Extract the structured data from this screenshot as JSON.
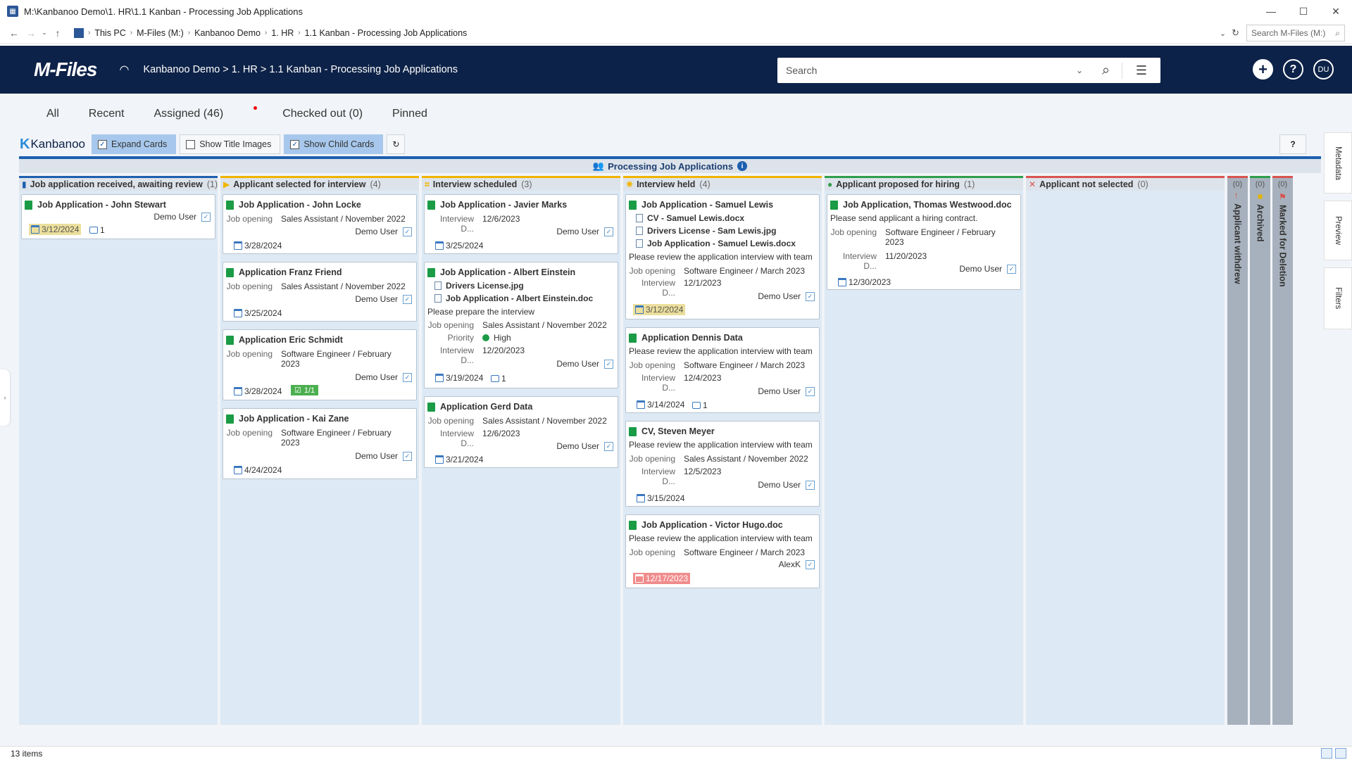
{
  "window": {
    "title": "M:\\Kanbanoo Demo\\1. HR\\1.1 Kanban - Processing Job Applications",
    "minimize": "—",
    "maximize": "☐",
    "close": "✕"
  },
  "address": {
    "crumbs": [
      "This PC",
      "M-Files (M:)",
      "Kanbanoo Demo",
      "1. HR",
      "1.1 Kanban - Processing Job Applications"
    ],
    "search_placeholder": "Search M-Files (M:)"
  },
  "header": {
    "logo": "M-Files",
    "path": "Kanbanoo Demo > 1. HR > 1.1 Kanban - Processing Job Applications",
    "search_placeholder": "Search",
    "user_initials": "DU"
  },
  "tabs": [
    "All",
    "Recent",
    "Assigned (46)",
    "Checked out (0)",
    "Pinned"
  ],
  "toolbar": {
    "logo": "Kanbanoo",
    "expand_cards": "Expand Cards",
    "show_title_images": "Show Title Images",
    "show_child_cards": "Show Child Cards",
    "help": "?"
  },
  "board": {
    "title": "Processing Job Applications"
  },
  "columns": [
    {
      "title": "Job application received, awaiting review",
      "count": "(1)",
      "color": "#1d5fae"
    },
    {
      "title": "Applicant selected for interview",
      "count": "(4)",
      "color": "#f0b400"
    },
    {
      "title": "Interview scheduled",
      "count": "(3)",
      "color": "#f0b400"
    },
    {
      "title": "Interview held",
      "count": "(4)",
      "color": "#f0b400"
    },
    {
      "title": "Applicant proposed for hiring",
      "count": "(1)",
      "color": "#2e9e4a"
    },
    {
      "title": "Applicant not selected",
      "count": "(0)",
      "color": "#d9534f"
    }
  ],
  "side_columns": [
    {
      "title": "Applicant withdrew",
      "count": "(0)",
      "color": "#d9534f"
    },
    {
      "title": "Archived",
      "count": "(0)",
      "color": "#2e9e4a"
    },
    {
      "title": "Marked for Deletion",
      "count": "(0)",
      "color": "#d9534f"
    }
  ],
  "labels": {
    "job_opening": "Job opening",
    "interview_d": "Interview D...",
    "priority": "Priority",
    "demo_user": "Demo User"
  },
  "cards": {
    "c1": {
      "title": "Job Application - John Stewart",
      "user": "Demo User",
      "date": "3/12/2024",
      "comments": "1"
    },
    "c2": {
      "title": "Job Application - John Locke",
      "job": "Sales Assistant / November 2022",
      "user": "Demo User",
      "date": "3/28/2024"
    },
    "c3": {
      "title": "Application Franz Friend",
      "job": "Sales Assistant / November 2022",
      "user": "Demo User",
      "date": "3/25/2024"
    },
    "c4": {
      "title": "Application Eric Schmidt",
      "job1": "Software Engineer / February",
      "job2": "2023",
      "user": "Demo User",
      "date": "3/28/2024",
      "tasks": "1/1"
    },
    "c5": {
      "title": "Job Application - Kai Zane",
      "job1": "Software Engineer / February",
      "job2": "2023",
      "user": "Demo User",
      "date": "4/24/2024"
    },
    "c6": {
      "title": "Job Application - Javier Marks",
      "interview": "12/6/2023",
      "user": "Demo User",
      "date": "3/25/2024"
    },
    "c7": {
      "title": "Job Application - Albert Einstein",
      "child1": "Drivers License.jpg",
      "child2": "Job Application - Albert Einstein.doc",
      "note": "Please prepare the interview",
      "job": "Sales Assistant / November 2022",
      "priority": "High",
      "interview": "12/20/2023",
      "user": "Demo User",
      "date": "3/19/2024",
      "comments": "1"
    },
    "c8": {
      "title": "Application Gerd Data",
      "job": "Sales Assistant / November 2022",
      "interview": "12/6/2023",
      "user": "Demo User",
      "date": "3/21/2024"
    },
    "c9": {
      "title": "Job Application - Samuel Lewis",
      "child1": "CV - Samuel Lewis.docx",
      "child2": "Drivers License - Sam Lewis.jpg",
      "child3": "Job Application - Samuel Lewis.docx",
      "note": "Please review the application interview with team",
      "job": "Software Engineer / March 2023",
      "interview": "12/1/2023",
      "user": "Demo User",
      "date": "3/12/2024"
    },
    "c10": {
      "title": "Application Dennis Data",
      "note": "Please review the application interview with team",
      "job": "Software Engineer / March 2023",
      "interview": "12/4/2023",
      "user": "Demo User",
      "date": "3/14/2024",
      "comments": "1"
    },
    "c11": {
      "title": "CV, Steven Meyer",
      "note": "Please review the application interview with team",
      "job": "Sales Assistant / November 2022",
      "interview": "12/5/2023",
      "user": "Demo User",
      "date": "3/15/2024"
    },
    "c12": {
      "title": "Job Application - Victor Hugo.doc",
      "note": "Please review the application interview with team",
      "job": "Software Engineer / March 2023",
      "user": "AlexK",
      "date": "12/17/2023"
    },
    "c13": {
      "title": "Job Application, Thomas Westwood.doc",
      "note": "Please send applicant a hiring contract.",
      "job1": "Software Engineer / February",
      "job2": "2023",
      "interview": "11/20/2023",
      "user": "Demo User",
      "date": "12/30/2023"
    }
  },
  "right_tabs": [
    "Metadata",
    "Preview",
    "Filters"
  ],
  "status": {
    "items": "13 items"
  },
  "colors": {
    "header_bg": "#0d2248",
    "accent": "#1d5fae",
    "board_bg": "#dde9f4"
  }
}
